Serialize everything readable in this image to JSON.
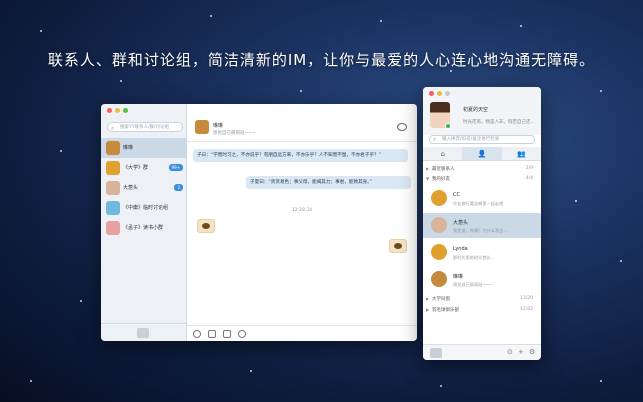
{
  "headline": "联系人、群和讨论组，简洁清新的IM，让你与最爱的人心连心地沟通无障碍。",
  "chat_window": {
    "search_placeholder": "搜索YY联系人/群/讨论组",
    "conversations": [
      {
        "name": "琳琳",
        "badge": "",
        "avatar_color": "#c58a3c"
      },
      {
        "name": "《大学》群",
        "badge": "99+",
        "avatar_color": "#e0a030"
      },
      {
        "name": "大葱头",
        "badge": "2",
        "avatar_color": "#d9b29a"
      },
      {
        "name": "《中庸》临时讨论组",
        "badge": "",
        "avatar_color": "#6fb7dd"
      },
      {
        "name": "《孟子》读书小群",
        "badge": "",
        "avatar_color": "#e6a0a0"
      }
    ],
    "header": {
      "name": "琳琳",
      "status": "感觉自己萌萌哒~~~"
    },
    "messages": [
      {
        "side": "left",
        "text": "子曰：“学而时习之，不亦说乎？有朋自远方来，不亦乐乎？人不知而不愠，不亦君子乎？”"
      },
      {
        "side": "right",
        "text": "子夏曰：“贤贤易色；事父母，能竭其力；事君，能致其身。”"
      }
    ],
    "timestamp": "12:28:34"
  },
  "contacts_window": {
    "profile": {
      "name": "初夏的天空",
      "signature": "时光荏苒，物是人非，假若自己还..."
    },
    "search_placeholder": "输入拼音/ID号/备注进行检索",
    "tabs": [
      "⌂",
      "👤",
      "👥"
    ],
    "groups": [
      {
        "name": "最近联系人",
        "count": "2/9",
        "expanded": false
      },
      {
        "name": "我的好友",
        "count": "4/4",
        "expanded": true
      },
      {
        "name": "大学同窗",
        "count": "13/20",
        "expanded": false
      },
      {
        "name": "羽毛球俱乐部",
        "count": "12/42",
        "expanded": false
      }
    ],
    "contacts": [
      {
        "name": "CC",
        "status": "毕业旅行要去哪里一起走吧",
        "avatar_color": "#e0a030"
      },
      {
        "name": "大葱头",
        "status": "我是谁，你猜？为什么我会...",
        "avatar_color": "#d9b29a"
      },
      {
        "name": "Lynda",
        "status": "那时光里的时光悠长...",
        "avatar_color": "#e0a030"
      },
      {
        "name": "琳琳",
        "status": "感觉自己萌萌哒~~~",
        "avatar_color": "#c58a3c"
      }
    ]
  }
}
